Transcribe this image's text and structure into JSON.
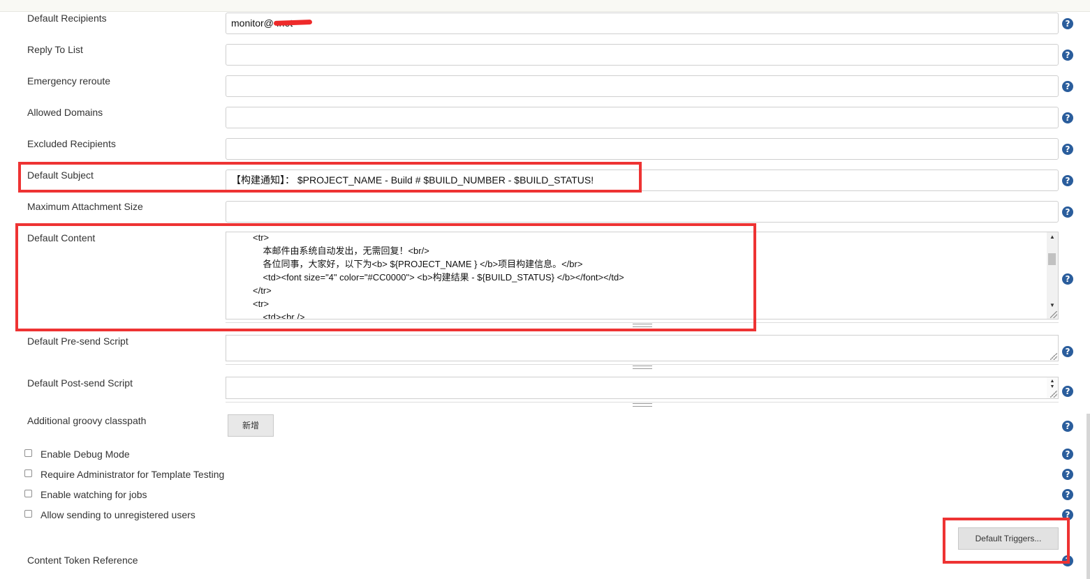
{
  "fields": {
    "default_recipients": {
      "label": "Default Recipients",
      "value": "monitor@               .net"
    },
    "reply_to_list": {
      "label": "Reply To List",
      "value": ""
    },
    "emergency_reroute": {
      "label": "Emergency reroute",
      "value": ""
    },
    "allowed_domains": {
      "label": "Allowed Domains",
      "value": ""
    },
    "excluded_recipients": {
      "label": "Excluded Recipients",
      "value": ""
    },
    "default_subject": {
      "label": "Default Subject",
      "value": "【构建通知】： $PROJECT_NAME - Build # $BUILD_NUMBER - $BUILD_STATUS!"
    },
    "max_attachment_size": {
      "label": "Maximum Attachment Size",
      "value": ""
    }
  },
  "default_content": {
    "label": "Default Content",
    "lines": [
      "<tr>",
      "    本邮件由系统自动发出，无需回复！<br/>",
      "    各位同事，大家好，以下为<b> ${PROJECT_NAME } </b>项目构建信息。</br>",
      "    <td><font size=\"4\" color=\"#CC0000\"> <b>构建结果 - ${BUILD_STATUS} </b></font></td>",
      "</tr>",
      "<tr>",
      "    <td><br />"
    ]
  },
  "pre_send_script": {
    "label": "Default Pre-send Script"
  },
  "post_send_script": {
    "label": "Default Post-send Script"
  },
  "groovy_classpath": {
    "label": "Additional groovy classpath",
    "add_button": "新增"
  },
  "checkboxes": [
    {
      "label": "Enable Debug Mode",
      "checked": false
    },
    {
      "label": "Require Administrator for Template Testing",
      "checked": false
    },
    {
      "label": "Enable watching for jobs",
      "checked": false
    },
    {
      "label": "Allow sending to unregistered users",
      "checked": false
    }
  ],
  "default_triggers_button": "Default Triggers...",
  "content_token_reference": {
    "label": "Content Token Reference"
  },
  "help_icon_glyph": "?",
  "colors": {
    "help_icon": "#2a5d9c",
    "highlight": "#ee3333"
  }
}
